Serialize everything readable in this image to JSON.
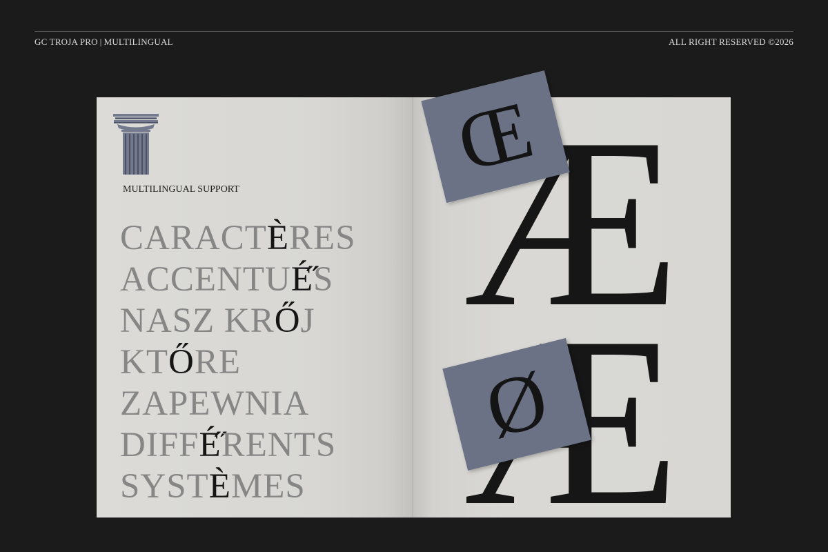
{
  "header": {
    "left_brand": "GC TROJA PRO",
    "left_separator": "|",
    "left_tagline": "MULTILINGUAL",
    "right_text": "ALL RIGHT RESERVED ©2026"
  },
  "left_page": {
    "section_label": "MULTILINGUAL SUPPORT",
    "words": [
      {
        "before": "CARACT",
        "accent": "È",
        "after": "RES"
      },
      {
        "before": "ACCENTU",
        "accent": "É̋",
        "after": "S"
      },
      {
        "before": "NASZ KR",
        "accent": "Ő",
        "after": "J"
      },
      {
        "before": "KT",
        "accent": "Ő",
        "after": "RE"
      },
      {
        "before": "ZAPEWNIA",
        "accent": "",
        "after": ""
      },
      {
        "before": "DIFF",
        "accent": "É̋",
        "after": "RENTS"
      },
      {
        "before": "SYST",
        "accent": "È",
        "after": "MES"
      }
    ]
  },
  "right_page": {
    "big_glyph_1": "Æ",
    "big_glyph_2": "Æ",
    "card_1_glyph": "Œ",
    "card_2_glyph": "Ø"
  },
  "colors": {
    "background": "#1b1b1b",
    "paper": "#d8d7d3",
    "card": "#6b7286",
    "ink": "#151515",
    "muted_ink": "#868686",
    "icon": "column-icon"
  }
}
